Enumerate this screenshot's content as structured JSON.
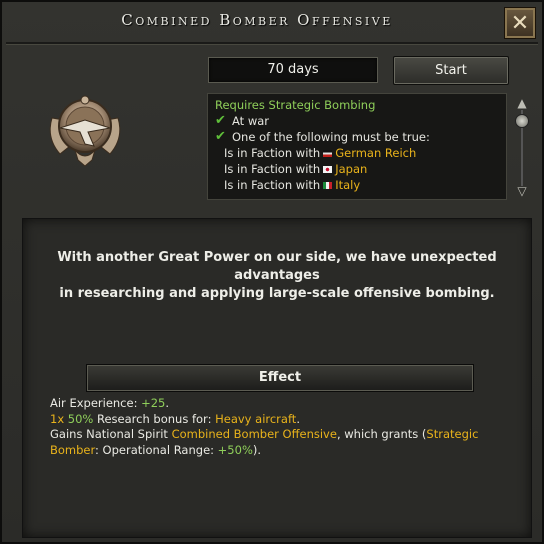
{
  "title": "Combined Bomber Offensive",
  "duration": "70 days",
  "start_label": "Start",
  "requirements": {
    "heading": "Requires Strategic Bombing",
    "at_war": "At war",
    "one_of": "One of the following must be true:",
    "faction_prefix": "Is in Faction with",
    "factions": [
      "German Reich",
      "Japan",
      "Italy"
    ]
  },
  "description_line1": "With another Great Power on our side, we have unexpected advantages",
  "description_line2": "in researching and applying large-scale offensive bombing.",
  "effect_label": "Effect",
  "effects": {
    "air_exp_label": "Air Experience: ",
    "air_exp_value": "+25",
    "air_exp_end": ".",
    "research_count": "1x",
    "research_pct": "50%",
    "research_text": " Research bonus for: ",
    "research_target": "Heavy aircraft",
    "research_end": ".",
    "spirit_prefix": "Gains National Spirit ",
    "spirit_name": "Combined Bomber Offensive",
    "spirit_mid": ", which grants (",
    "spirit_mod": "Strategic Bomber",
    "spirit_mod_text": ": Operational Range: ",
    "spirit_mod_value": "+50%",
    "spirit_end": ")."
  },
  "colors": {
    "highlight": "#e9b31b",
    "positive": "#8fcf5a",
    "check": "#5fbf3a"
  },
  "icons": [
    "close-icon",
    "bomber-medal-icon",
    "check-icon",
    "flag-icon",
    "scroll-up-icon",
    "scroll-down-icon"
  ]
}
